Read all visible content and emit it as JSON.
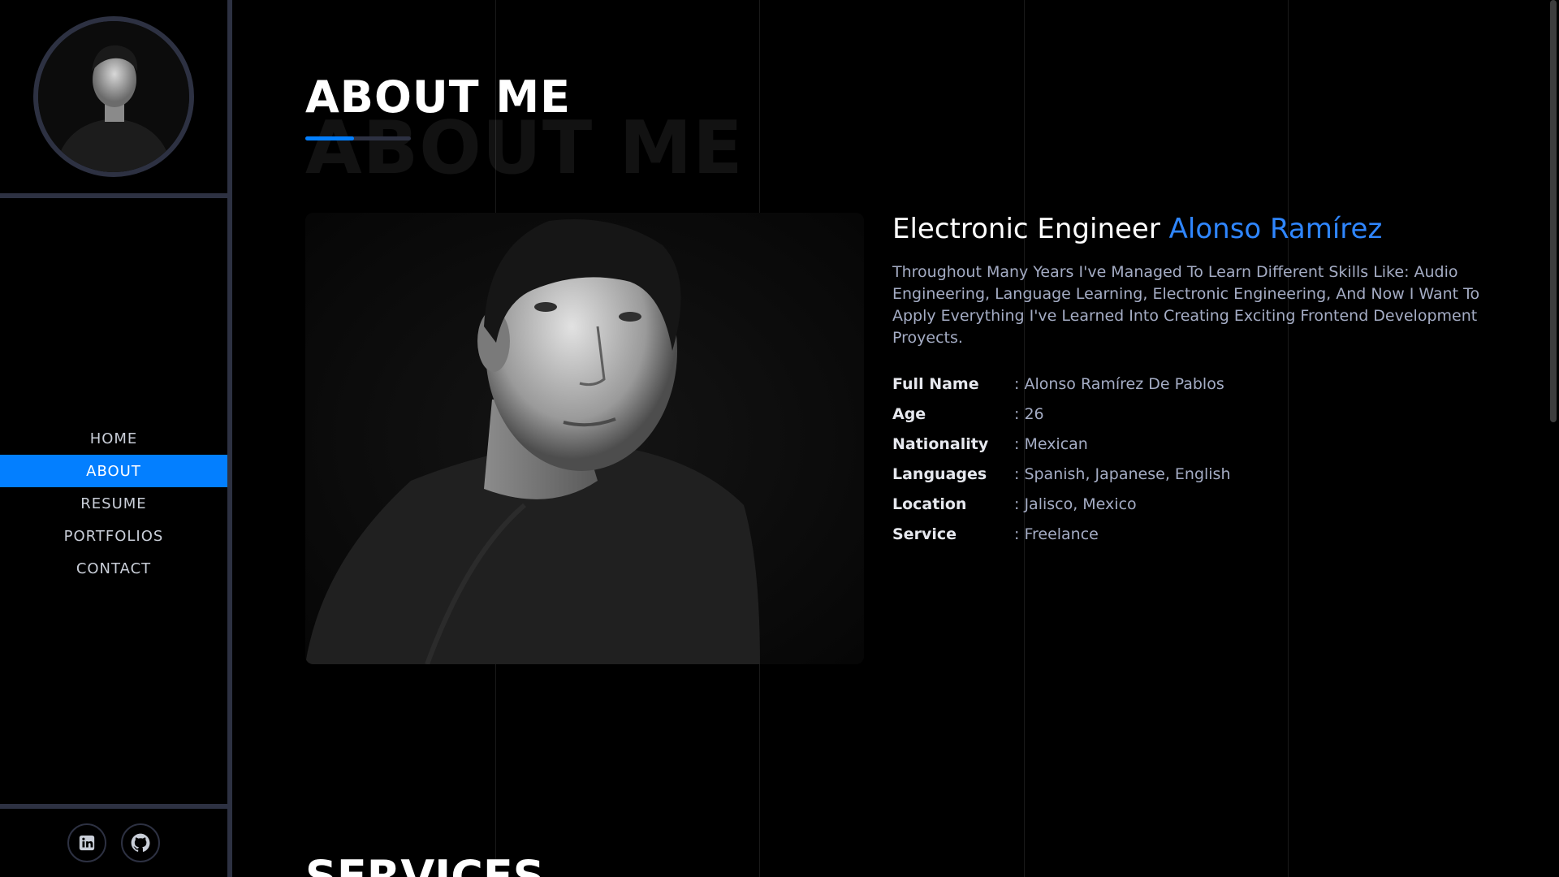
{
  "sidebar": {
    "nav": [
      {
        "label": "HOME",
        "active": false
      },
      {
        "label": "ABOUT",
        "active": true
      },
      {
        "label": "RESUME",
        "active": false
      },
      {
        "label": "PORTFOLIOS",
        "active": false
      },
      {
        "label": "CONTACT",
        "active": false
      }
    ],
    "social": [
      {
        "icon": "linkedin-icon"
      },
      {
        "icon": "github-icon"
      }
    ]
  },
  "about": {
    "title": "ABOUT ME",
    "title_shadow": "ABOUT ME",
    "heading_prefix": "Electronic Engineer",
    "heading_name": "Alonso Ramírez",
    "description": "Throughout Many Years I've Managed To Learn Different Skills Like: Audio Engineering, Language Learning, Electronic Engineering, And Now I Want To Apply Everything I've Learned Into Creating Exciting Frontend Development Proyects.",
    "details": [
      {
        "label": "Full Name",
        "value": ": Alonso Ramírez De Pablos"
      },
      {
        "label": "Age",
        "value": ": 26"
      },
      {
        "label": "Nationality",
        "value": ": Mexican"
      },
      {
        "label": "Languages",
        "value": ": Spanish, Japanese, English"
      },
      {
        "label": "Location",
        "value": ": Jalisco, Mexico"
      },
      {
        "label": "Service",
        "value": ": Freelance"
      }
    ]
  },
  "services": {
    "title": "SERVICES"
  },
  "colors": {
    "accent": "#037fff",
    "border": "#2d3142",
    "text_muted": "#a4acc4"
  }
}
